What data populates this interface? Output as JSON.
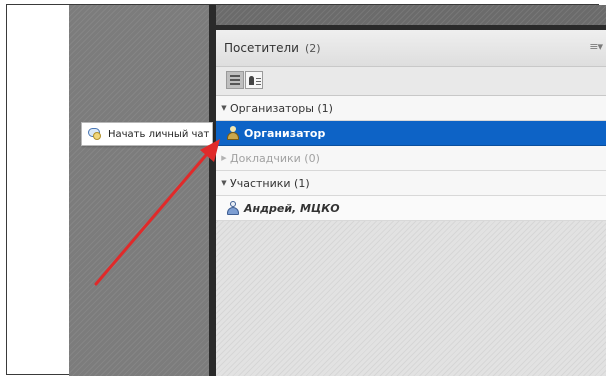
{
  "panel": {
    "title": "Посетители",
    "count": "(2)",
    "menu_icon": "≡▾"
  },
  "view_buttons": [
    {
      "icon": "list-view-icon",
      "active": true
    },
    {
      "icon": "person-list-icon",
      "active": false
    }
  ],
  "groups": [
    {
      "label": "Организаторы (1)",
      "expanded": true
    },
    {
      "label": "Докладчики (0)",
      "expanded": false
    },
    {
      "label": "Участники (1)",
      "expanded": true
    }
  ],
  "attendees": [
    {
      "name": "Организатор",
      "role": "host",
      "selected": true
    },
    {
      "name": "Андрей, МЦКО",
      "role": "participant",
      "selected": false
    }
  ],
  "context_menu": {
    "item_label": "Начать личный чат"
  },
  "colors": {
    "selection": "#0d63c6",
    "arrow": "#e02a2a"
  }
}
